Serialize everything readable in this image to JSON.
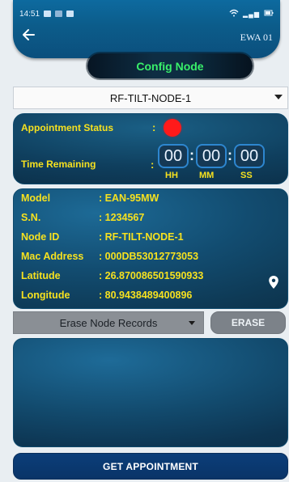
{
  "status_bar": {
    "time": "14:51",
    "right_text": " ill"
  },
  "header": {
    "back_icon": "back-arrow-icon",
    "right_label": "EWA 01",
    "title": "Config Node"
  },
  "node_select": {
    "selected": "RF-TILT-NODE-1"
  },
  "status_panel": {
    "appointment_status_label": "Appointment Status",
    "time_remaining_label": "Time Remaining",
    "colon": ":",
    "status_color": "#ff1a1a",
    "hh": "00",
    "mm": "00",
    "ss": "00",
    "hh_label": "HH",
    "mm_label": "MM",
    "ss_label": "SS"
  },
  "info": {
    "rows": [
      {
        "k": "Model",
        "v": ": EAN-95MW"
      },
      {
        "k": "S.N.",
        "v": ": 1234567"
      },
      {
        "k": "Node ID",
        "v": ": RF-TILT-NODE-1"
      },
      {
        "k": "Mac Address",
        "v": ": 000DB53012773053"
      },
      {
        "k": "Latitude",
        "v": ": 26.870086501590933"
      },
      {
        "k": "Longitude",
        "v": ": 80.9438489400896"
      }
    ],
    "location_icon": "location-pin-icon"
  },
  "erase": {
    "select_label": "Erase Node Records",
    "button_label": "ERASE"
  },
  "footer": {
    "button_label": "GET APPOINTMENT"
  },
  "colors": {
    "accent_green": "#39f06a",
    "label_yellow": "#f6e11f",
    "header_blue": "#0c5c8a",
    "button_navy": "#0b3e79"
  }
}
